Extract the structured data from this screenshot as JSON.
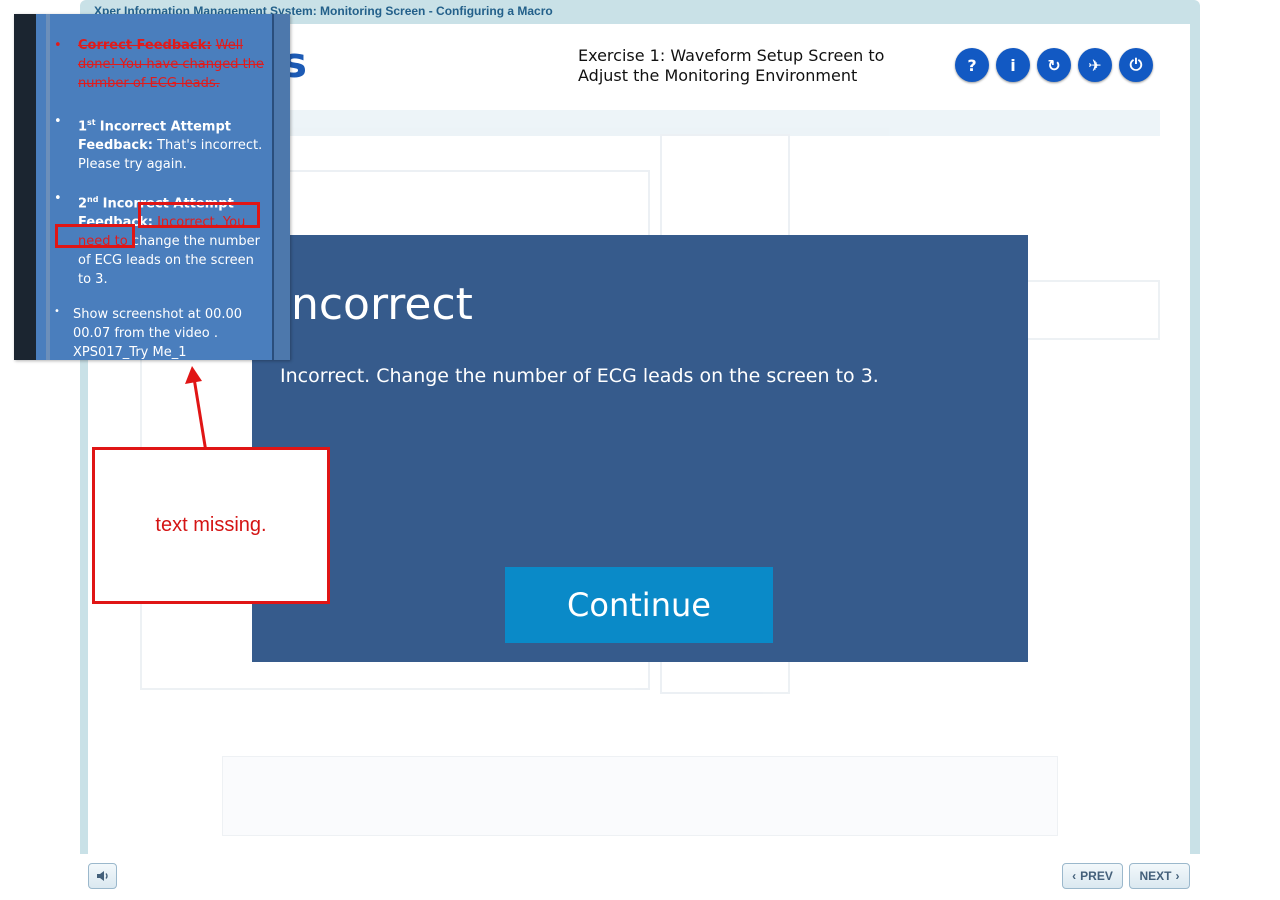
{
  "window": {
    "title": "Xper Information Management System: Monitoring Screen - Configuring a Macro",
    "logo_fragment": "s"
  },
  "header": {
    "exercise_title": "Exercise 1: Waveform Setup Screen to Adjust the Monitoring Environment",
    "buttons": [
      {
        "name": "help",
        "icon": "?",
        "color": "#1259c3"
      },
      {
        "name": "info",
        "icon": "i"
      },
      {
        "name": "restart",
        "icon": "↻"
      },
      {
        "name": "navigate",
        "icon": "✈"
      },
      {
        "name": "exit",
        "icon": "⏻"
      }
    ]
  },
  "dialog": {
    "heading": "Incorrect",
    "message": "Incorrect. Change the number of ECG leads on the screen to 3.",
    "continue_label": "Continue",
    "background": "#365b8c",
    "button_color": "#0a8ac8"
  },
  "nav": {
    "prev_label": "PREV",
    "next_label": "NEXT",
    "audio_icon": "speaker-icon"
  },
  "notes": {
    "correct_label": "Correct Feedback:",
    "correct_text": "Well done! You have changed the number of ECG leads.",
    "first_label_num": "1",
    "first_label_sup": "st",
    "first_label_rest": "Incorrect Attempt Feedback:",
    "first_text": "That's incorrect. Please try again.",
    "second_label_num": "2",
    "second_label_sup": "nd",
    "second_label_rest": "Incorrect Attempt Feedback:",
    "second_text_red": "Incorrect. You need to",
    "second_text_rest": "change the number of ECG leads on the screen to 3.",
    "screenshot_note": "Show screenshot  at 00.00 00.07 from the video . XPS017_Try Me_1"
  },
  "annotation": {
    "callout_text": "text missing.",
    "color": "#e01515"
  }
}
